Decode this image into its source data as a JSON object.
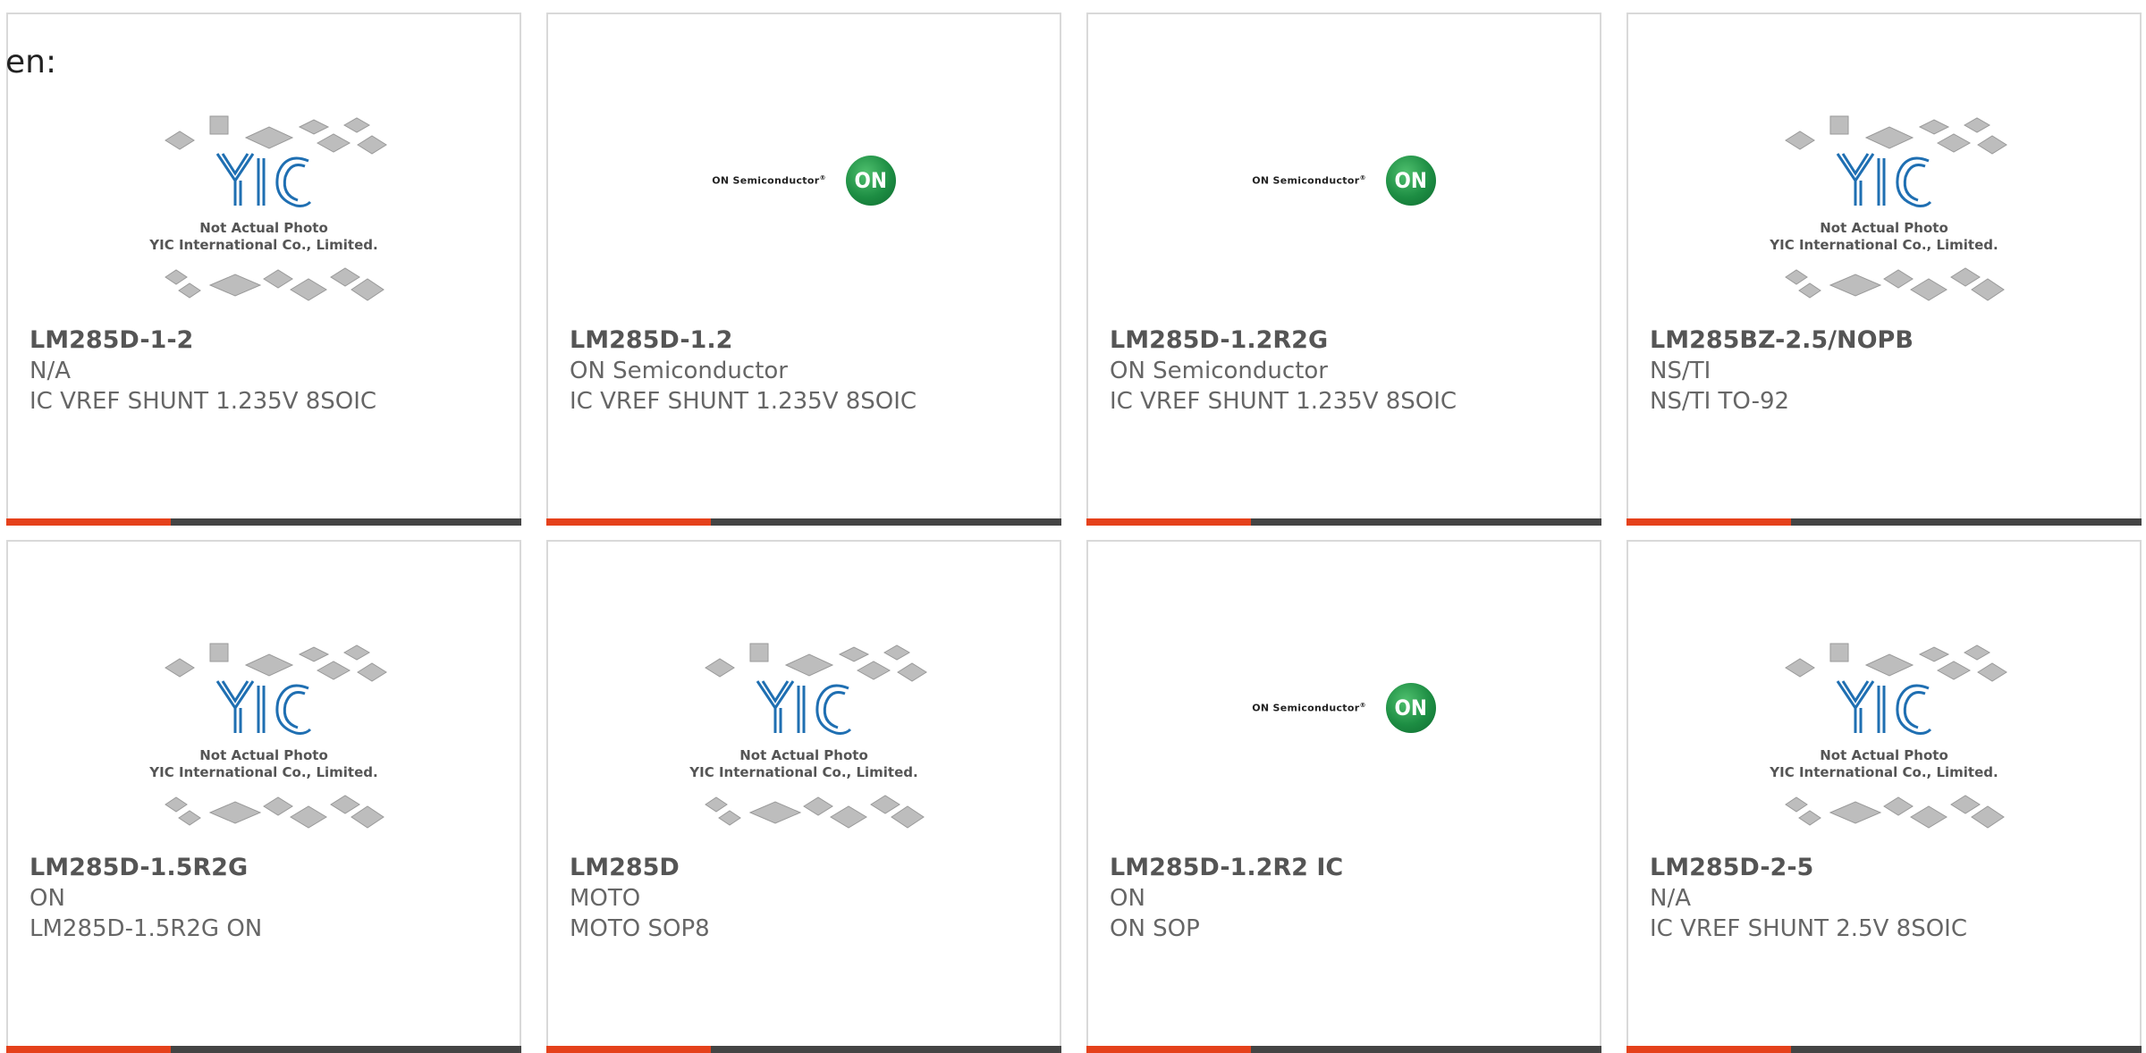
{
  "corner_text": "en:",
  "placeholder": {
    "line1": "Not Actual Photo",
    "line2": "YIC International Co., Limited."
  },
  "on_logo": {
    "brand": "ON Semiconductor",
    "mark": "ON"
  },
  "colors": {
    "accent_bar": "#e5411b",
    "bar_base": "#444444",
    "yic_blue": "#1f6fb2",
    "on_green": "#1d8d43"
  },
  "products": [
    {
      "part": "LM285D-1-2",
      "maker": "N/A",
      "desc": "IC VREF SHUNT 1.235V 8SOIC",
      "image": "yic-placeholder"
    },
    {
      "part": "LM285D-1.2",
      "maker": "ON Semiconductor",
      "desc": "IC VREF SHUNT 1.235V 8SOIC",
      "image": "on-semi-logo"
    },
    {
      "part": "LM285D-1.2R2G",
      "maker": "ON Semiconductor",
      "desc": "IC VREF SHUNT 1.235V 8SOIC",
      "image": "on-semi-logo"
    },
    {
      "part": "LM285BZ-2.5/NOPB",
      "maker": "NS/TI",
      "desc": "NS/TI TO-92",
      "image": "yic-placeholder"
    },
    {
      "part": "LM285D-1.5R2G",
      "maker": "ON",
      "desc": "LM285D-1.5R2G ON",
      "image": "yic-placeholder"
    },
    {
      "part": "LM285D",
      "maker": "MOTO",
      "desc": "MOTO SOP8",
      "image": "yic-placeholder"
    },
    {
      "part": "LM285D-1.2R2 IC",
      "maker": "ON",
      "desc": "ON SOP",
      "image": "on-semi-logo"
    },
    {
      "part": "LM285D-2-5",
      "maker": "N/A",
      "desc": "IC VREF SHUNT 2.5V 8SOIC",
      "image": "yic-placeholder"
    }
  ]
}
